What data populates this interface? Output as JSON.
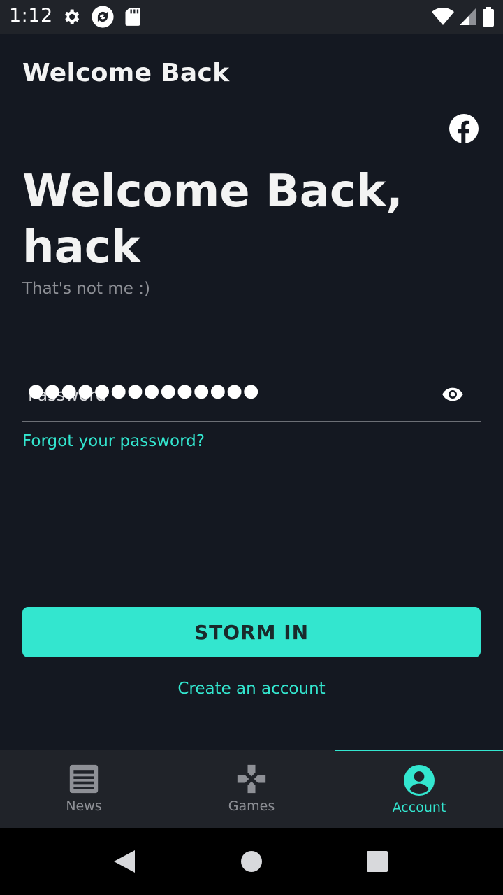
{
  "status_bar": {
    "time": "1:12",
    "left_icons": [
      "gear-icon",
      "media-sync-icon",
      "sd-card-icon"
    ],
    "right_icons": [
      "wifi-icon",
      "cellular-signal-icon",
      "battery-icon"
    ]
  },
  "header": {
    "title": "Welcome Back",
    "social_icon": "facebook-icon"
  },
  "main": {
    "heading": "Welcome Back, hack",
    "not_me": "That's not me :)",
    "password": {
      "label": "Password",
      "value": "●●●●●●●●●●●●●●",
      "toggle_icon": "eye-icon"
    },
    "forgot_password": "Forgot your password?",
    "submit_label": "STORM IN",
    "create_account": "Create an account"
  },
  "bottom_nav": {
    "items": [
      {
        "label": "News",
        "icon": "news-icon",
        "active": false
      },
      {
        "label": "Games",
        "icon": "gamepad-icon",
        "active": false
      },
      {
        "label": "Account",
        "icon": "account-icon",
        "active": true
      }
    ]
  },
  "colors": {
    "background": "#141821",
    "accent": "#33e6cf",
    "nav_background": "#202329",
    "muted_text": "#8e9096"
  }
}
